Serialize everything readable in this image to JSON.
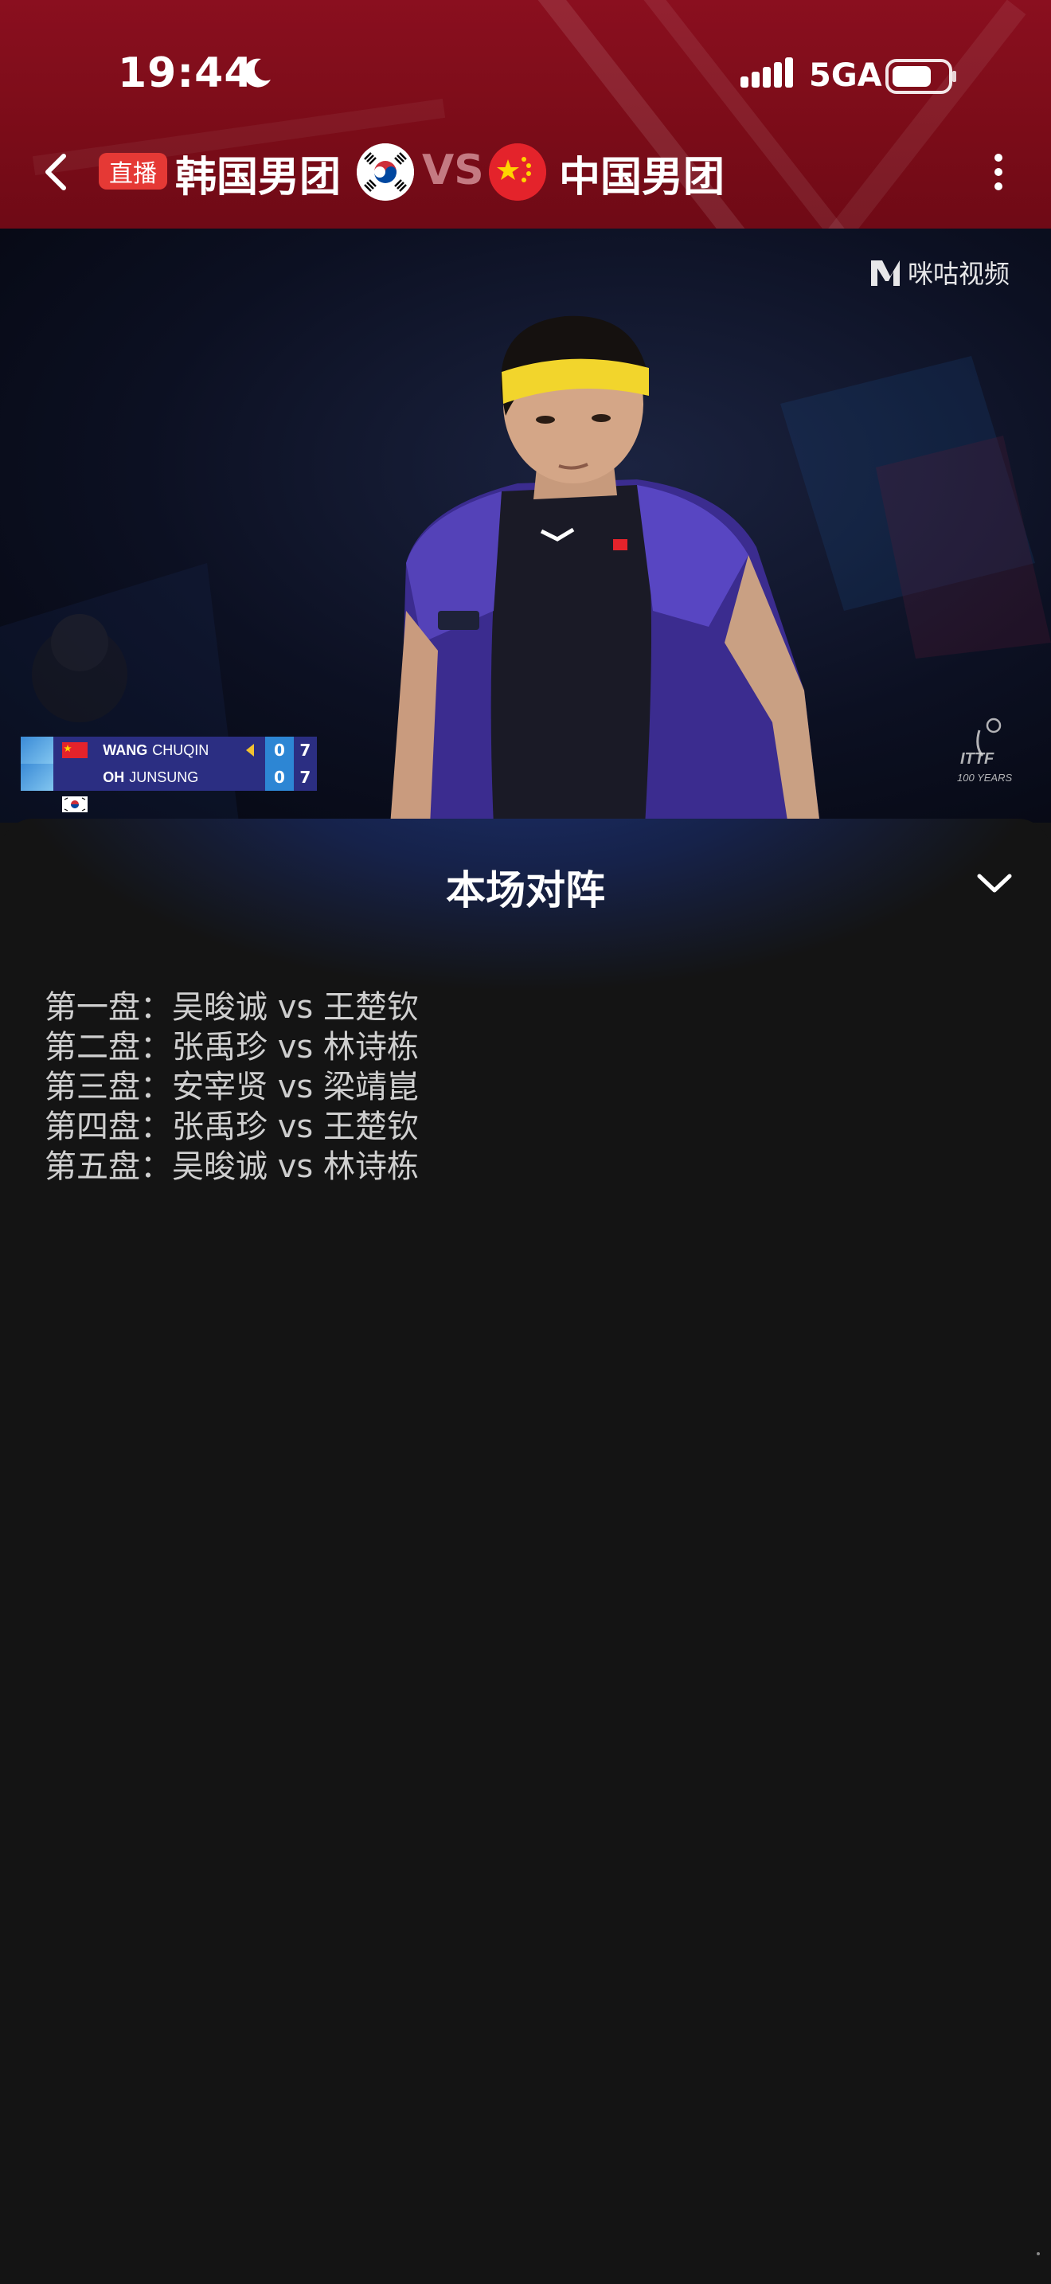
{
  "status_bar": {
    "time": "19:44",
    "network": "5GA",
    "icons": [
      "moon-icon",
      "signal-icon",
      "battery-icon"
    ]
  },
  "header": {
    "live_badge": "直播",
    "home_team": "韩国男团",
    "vs": "VS",
    "away_team": "中国男团",
    "home_flag": "korea-flag-icon",
    "away_flag": "china-flag-icon",
    "colors": {
      "background": "#7a0c18",
      "badge": "#e53935"
    }
  },
  "video": {
    "watermark": "咪咕视频",
    "scoreboard": {
      "rows": [
        {
          "flag": "china-flag-icon",
          "surname": "WANG",
          "given": "CHUQIN",
          "serving": true,
          "games": "0",
          "points": "7"
        },
        {
          "flag": "korea-flag-icon",
          "surname": "OH",
          "given": "JUNSUNG",
          "serving": false,
          "games": "0",
          "points": "7"
        }
      ]
    },
    "corner_logo": "itf-100-years-logo"
  },
  "sheet": {
    "title": "本场对阵",
    "lineups": [
      "第一盘：吴晙诚 vs 王楚钦",
      "第二盘：张禹珍 vs 林诗栋",
      "第三盘：安宰贤 vs 梁靖崑",
      "第四盘：张禹珍 vs 王楚钦",
      "第五盘：吴晙诚 vs 林诗栋"
    ]
  }
}
